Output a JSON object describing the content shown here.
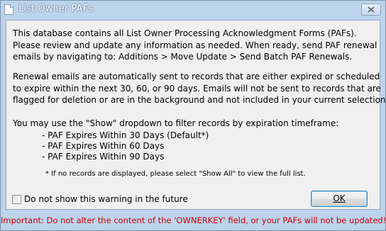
{
  "window": {
    "title": "List Owner PAFs"
  },
  "intro": {
    "lines": [
      "This database contains all List Owner Processing Acknowledgment Forms (PAFs).",
      "Please review and update any information as needed. When ready, send PAF renewal",
      "emails by navigating to: Additions > Move Update > Send Batch PAF Renewals."
    ]
  },
  "renewal": {
    "lines": [
      "Renewal emails are automatically sent to records that are either expired or scheduled",
      "to expire within the next 30, 60, or 90 days. Emails will not be sent to records that are",
      "flagged for deletion or are in the background and not included in your current selection."
    ]
  },
  "show": {
    "line": "You may use the \"Show\" dropdown to filter records by expiration timeframe:",
    "options": [
      "- PAF Expires Within 30 Days (Default*)",
      "- PAF Expires Within 60 Days",
      "- PAF Expires Within 90 Days"
    ],
    "footnote": "* If no records are displayed, please select \"Show All\" to view the full list."
  },
  "controls": {
    "checkbox_label": "Do not show this warning in the future",
    "checkbox_checked": false,
    "ok_label": "OK"
  },
  "footer": {
    "warning": "Important: Do not alter the content of the 'OWNERKEY' field, or your PAFs will not be updated!",
    "warning_color": "#d20000"
  },
  "icons": {
    "app": "document-icon",
    "close": "close-icon",
    "checkbox": "checkbox-icon"
  }
}
